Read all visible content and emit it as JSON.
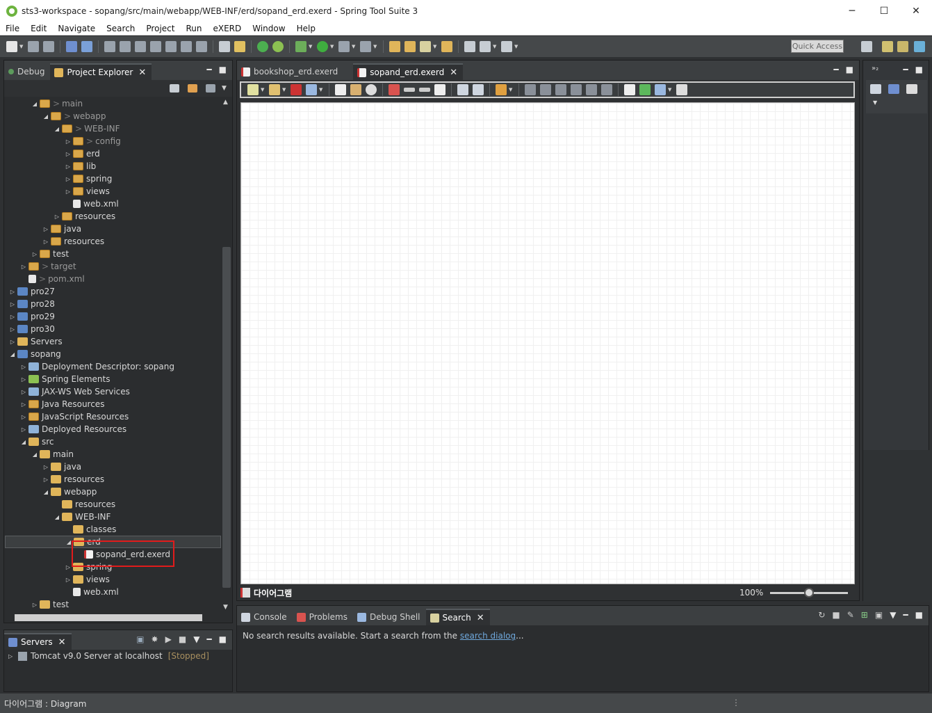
{
  "window": {
    "title": "sts3-workspace - sopang/src/main/webapp/WEB-INF/erd/sopand_erd.exerd - Spring Tool Suite 3",
    "controls": [
      "─",
      "☐",
      "✕"
    ]
  },
  "menu": [
    "File",
    "Edit",
    "Navigate",
    "Search",
    "Project",
    "Run",
    "eXERD",
    "Window",
    "Help"
  ],
  "toolbar": {
    "quick_access": "Quick Access"
  },
  "explorer": {
    "tabs": [
      {
        "label": "Debug",
        "active": false
      },
      {
        "label": "Project Explorer",
        "active": true
      }
    ],
    "tree": [
      {
        "label": "main",
        "prefix": ">",
        "indent": 2,
        "arrow": "open",
        "icon": "pkg",
        "dim": true
      },
      {
        "label": "webapp",
        "prefix": ">",
        "indent": 3,
        "arrow": "open",
        "icon": "pkg",
        "dim": true
      },
      {
        "label": "WEB-INF",
        "prefix": ">",
        "indent": 4,
        "arrow": "open",
        "icon": "pkg",
        "dim": true
      },
      {
        "label": "config",
        "prefix": ">",
        "indent": 5,
        "arrow": "closed",
        "icon": "pkg",
        "dim": true
      },
      {
        "label": "erd",
        "prefix": "",
        "indent": 5,
        "arrow": "closed",
        "icon": "pkg",
        "dim": false
      },
      {
        "label": "lib",
        "prefix": "",
        "indent": 5,
        "arrow": "closed",
        "icon": "pkg",
        "dim": false
      },
      {
        "label": "spring",
        "prefix": "",
        "indent": 5,
        "arrow": "closed",
        "icon": "pkg",
        "dim": false
      },
      {
        "label": "views",
        "prefix": "",
        "indent": 5,
        "arrow": "closed",
        "icon": "pkg",
        "dim": false
      },
      {
        "label": "web.xml",
        "prefix": "",
        "indent": 5,
        "arrow": "none",
        "icon": "file",
        "dim": false
      },
      {
        "label": "resources",
        "prefix": "",
        "indent": 4,
        "arrow": "closed",
        "icon": "pkg",
        "dim": false
      },
      {
        "label": "java",
        "prefix": "",
        "indent": 3,
        "arrow": "closed",
        "icon": "pkg",
        "dim": false
      },
      {
        "label": "resources",
        "prefix": "",
        "indent": 3,
        "arrow": "closed",
        "icon": "pkg",
        "dim": false
      },
      {
        "label": "test",
        "prefix": "",
        "indent": 2,
        "arrow": "closed",
        "icon": "pkg",
        "dim": false
      },
      {
        "label": "target",
        "prefix": ">",
        "indent": 1,
        "arrow": "closed",
        "icon": "pkg",
        "dim": true
      },
      {
        "label": "pom.xml",
        "prefix": ">",
        "indent": 1,
        "arrow": "none",
        "icon": "file",
        "dim": true
      },
      {
        "label": "pro27",
        "prefix": "",
        "indent": 0,
        "arrow": "closed",
        "icon": "proj",
        "dim": false
      },
      {
        "label": "pro28",
        "prefix": "",
        "indent": 0,
        "arrow": "closed",
        "icon": "proj",
        "dim": false
      },
      {
        "label": "pro29",
        "prefix": "",
        "indent": 0,
        "arrow": "closed",
        "icon": "proj",
        "dim": false
      },
      {
        "label": "pro30",
        "prefix": "",
        "indent": 0,
        "arrow": "closed",
        "icon": "proj",
        "dim": false
      },
      {
        "label": "Servers",
        "prefix": "",
        "indent": 0,
        "arrow": "closed",
        "icon": "folder",
        "dim": false
      },
      {
        "label": "sopang",
        "prefix": "",
        "indent": 0,
        "arrow": "open",
        "icon": "proj",
        "dim": false
      },
      {
        "label": "Deployment Descriptor: sopang",
        "prefix": "",
        "indent": 1,
        "arrow": "closed",
        "icon": "misc",
        "dim": false
      },
      {
        "label": "Spring Elements",
        "prefix": "",
        "indent": 1,
        "arrow": "closed",
        "icon": "spring",
        "dim": false
      },
      {
        "label": "JAX-WS Web Services",
        "prefix": "",
        "indent": 1,
        "arrow": "closed",
        "icon": "misc",
        "dim": false
      },
      {
        "label": "Java Resources",
        "prefix": "",
        "indent": 1,
        "arrow": "closed",
        "icon": "pkg",
        "dim": false
      },
      {
        "label": "JavaScript Resources",
        "prefix": "",
        "indent": 1,
        "arrow": "closed",
        "icon": "pkg",
        "dim": false
      },
      {
        "label": "Deployed Resources",
        "prefix": "",
        "indent": 1,
        "arrow": "closed",
        "icon": "misc",
        "dim": false
      },
      {
        "label": "src",
        "prefix": "",
        "indent": 1,
        "arrow": "open",
        "icon": "folder",
        "dim": false
      },
      {
        "label": "main",
        "prefix": "",
        "indent": 2,
        "arrow": "open",
        "icon": "folder",
        "dim": false
      },
      {
        "label": "java",
        "prefix": "",
        "indent": 3,
        "arrow": "closed",
        "icon": "folder",
        "dim": false
      },
      {
        "label": "resources",
        "prefix": "",
        "indent": 3,
        "arrow": "closed",
        "icon": "folder",
        "dim": false
      },
      {
        "label": "webapp",
        "prefix": "",
        "indent": 3,
        "arrow": "open",
        "icon": "folder",
        "dim": false
      },
      {
        "label": "resources",
        "prefix": "",
        "indent": 4,
        "arrow": "none",
        "icon": "folder",
        "dim": false
      },
      {
        "label": "WEB-INF",
        "prefix": "",
        "indent": 4,
        "arrow": "open",
        "icon": "folder",
        "dim": false
      },
      {
        "label": "classes",
        "prefix": "",
        "indent": 5,
        "arrow": "none",
        "icon": "folder",
        "dim": false
      },
      {
        "label": "erd",
        "prefix": "",
        "indent": 5,
        "arrow": "open",
        "icon": "folder",
        "dim": false,
        "selected": true
      },
      {
        "label": "sopand_erd.exerd",
        "prefix": "",
        "indent": 6,
        "arrow": "none",
        "icon": "erd",
        "dim": false
      },
      {
        "label": "spring",
        "prefix": "",
        "indent": 5,
        "arrow": "closed",
        "icon": "folder",
        "dim": false
      },
      {
        "label": "views",
        "prefix": "",
        "indent": 5,
        "arrow": "closed",
        "icon": "folder",
        "dim": false
      },
      {
        "label": "web.xml",
        "prefix": "",
        "indent": 5,
        "arrow": "none",
        "icon": "file",
        "dim": false
      },
      {
        "label": "test",
        "prefix": "",
        "indent": 2,
        "arrow": "closed",
        "icon": "folder",
        "dim": false
      }
    ]
  },
  "servers": {
    "tab": "Servers",
    "entry": "Tomcat v9.0 Server at localhost",
    "state": "[Stopped]"
  },
  "editor": {
    "tabs": [
      {
        "label": "bookshop_erd.exerd",
        "active": false
      },
      {
        "label": "sopand_erd.exerd",
        "active": true
      }
    ],
    "diagram_tab": "다이어그램",
    "zoom": "100%",
    "zoom_level": 0.5
  },
  "bottom": {
    "tabs": [
      {
        "label": "Console",
        "active": false
      },
      {
        "label": "Problems",
        "active": false
      },
      {
        "label": "Debug Shell",
        "active": false
      },
      {
        "label": "Search",
        "active": true
      }
    ],
    "message": "No search results available. Start a search from the ",
    "link": "search dialog",
    "suffix": "..."
  },
  "status": {
    "text": "다이어그램 : Diagram"
  },
  "colors": {
    "accent": "#e21b1b",
    "link": "#6fa8dc",
    "stopped": "#a88f5f"
  }
}
